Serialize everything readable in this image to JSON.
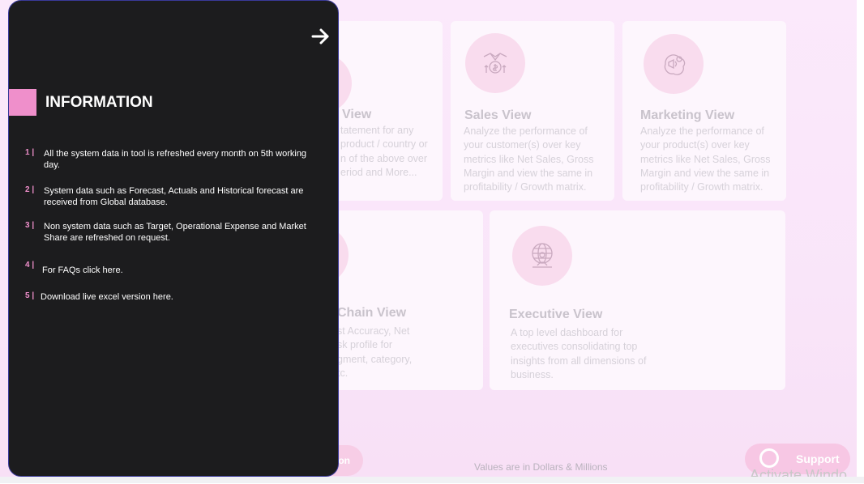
{
  "panel": {
    "heading": "INFORMATION",
    "items": [
      {
        "num": "1 |",
        "text": "All the system data in tool is refreshed every month on 5th working day."
      },
      {
        "num": "2 |",
        "text": "System data such as Forecast, Actuals and Historical forecast are received from Global database."
      },
      {
        "num": "3 |",
        "text": "Non system data such as Target, Operational Expense and Market Share are refreshed on request."
      },
      {
        "num": "4 |",
        "text": "For FAQs click here."
      },
      {
        "num": "5 |",
        "text": "Download live excel version here."
      }
    ]
  },
  "cards": {
    "product": {
      "title": "View",
      "desc": "tatement for any\nproduct / country or\nn of the above over\neriod and More..."
    },
    "sales": {
      "title": "Sales View",
      "desc": "Analyze the performance of\nyour customer(s) over key\nmetrics like Net Sales, Gross\nMargin and view the same in\nprofitability / Growth matrix."
    },
    "marketing": {
      "title": "Marketing View",
      "desc": "Analyze the performance of\nyour product(s) over key\nmetrics like Net Sales, Gross\nMargin and view the same in\nprofitability / Growth matrix."
    },
    "supply": {
      "title": "Chain View",
      "desc": "st Accuracy, Net\nsk profile for\ngment, category,\ntc."
    },
    "executive": {
      "title": "Executive View",
      "desc": "A top level dashboard for\nexecutives consolidating top\ninsights from all dimensions of\nbusiness."
    }
  },
  "footer": {
    "note": "Values are in Dollars & Millions",
    "pill_label": "on",
    "support_label": "Support",
    "watermark": "Activate Windo"
  },
  "colors": {
    "accent": "#ef8fcb",
    "panel_bg": "#1c1c1e",
    "page_bg": "#fbe9fb"
  }
}
